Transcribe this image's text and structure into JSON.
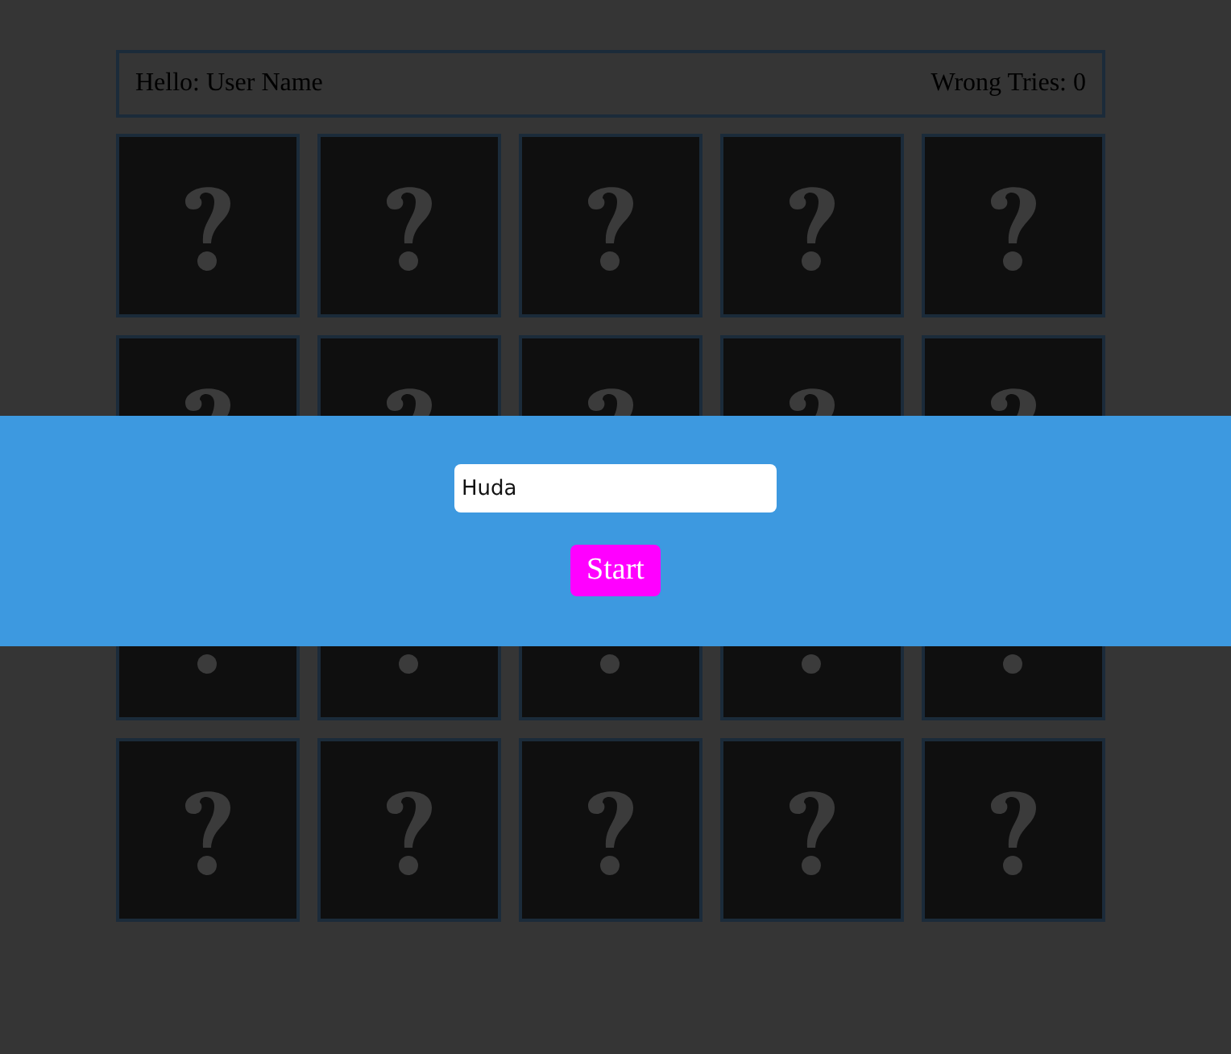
{
  "header": {
    "greeting": "Hello: User Name",
    "wrong_tries": "Wrong Tries: 0"
  },
  "cards": [
    {
      "face_down": true
    },
    {
      "face_down": true
    },
    {
      "face_down": true
    },
    {
      "face_down": true
    },
    {
      "face_down": true
    },
    {
      "face_down": true
    },
    {
      "face_down": true
    },
    {
      "face_down": true
    },
    {
      "face_down": true
    },
    {
      "face_down": true
    },
    {
      "face_down": true
    },
    {
      "face_down": true
    },
    {
      "face_down": true
    },
    {
      "face_down": true
    },
    {
      "face_down": true
    },
    {
      "face_down": true
    },
    {
      "face_down": true
    },
    {
      "face_down": true
    },
    {
      "face_down": true
    },
    {
      "face_down": true
    }
  ],
  "start_overlay": {
    "name_field": {
      "value": "Huda"
    },
    "start_button": "Start"
  }
}
